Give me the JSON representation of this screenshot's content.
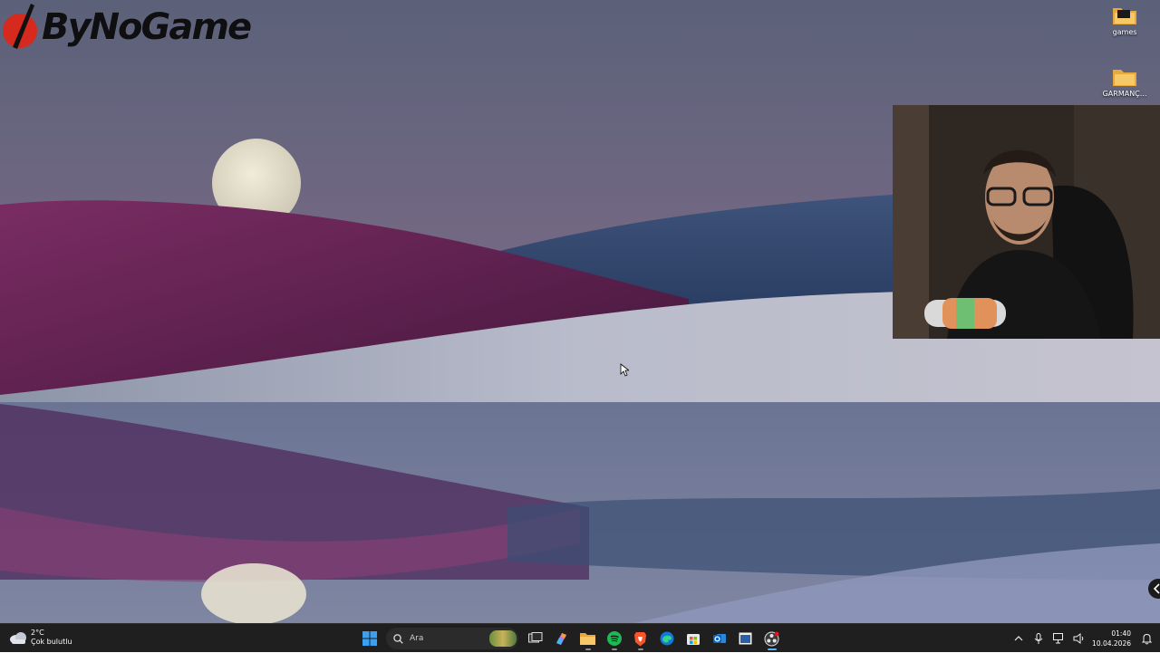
{
  "brand": {
    "logo_text": "ByNoGame"
  },
  "desktop_icons": [
    {
      "label": "games"
    },
    {
      "label": "GARMANÇ..."
    }
  ],
  "taskbar": {
    "weather": {
      "temp": "2°C",
      "condition": "Çok bulutlu"
    },
    "search": {
      "placeholder": "Ara"
    },
    "apps": [
      "start",
      "task-view",
      "copilot",
      "file-explorer",
      "spotify",
      "brave",
      "edge",
      "microsoft-store",
      "outlook",
      "unknown-app",
      "obs-studio"
    ],
    "clock": {
      "time": "01:40",
      "date": "10.04.2026"
    }
  },
  "colors": {
    "taskbar_bg": "#1f1f1f",
    "accent": "#0078d4",
    "spotify": "#1db954",
    "brave": "#fb542b",
    "brand_red": "#d62a1e"
  }
}
